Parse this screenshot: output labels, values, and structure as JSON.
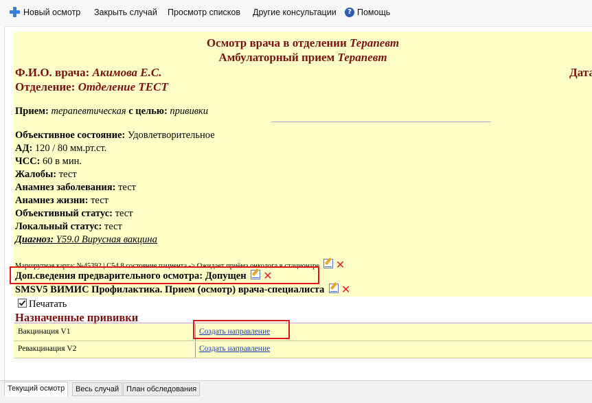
{
  "toolbar": {
    "new_exam": "Новый осмотр",
    "close_case": "Закрыть случай",
    "view_lists": "Просмотр списков",
    "other_consults": "Другие консультации",
    "help": "Помощь",
    "help_icon_glyph": "?"
  },
  "header": {
    "title1_prefix": "Осмотр врача в отделении ",
    "title1_dept": "Терапевт",
    "title2_prefix": "Амбулаторный прием ",
    "title2_dept": "Терапевт"
  },
  "doctor": {
    "label": "Ф.И.О. врача: ",
    "name": "Акимова Е.С.",
    "date_label": "Дата"
  },
  "department": {
    "label": "Отделение: ",
    "name": "Отделение ТЕСТ"
  },
  "reception": {
    "label": "Прием: ",
    "type": "терапевтическая",
    "purpose_label": " с целью: ",
    "purpose": "прививки"
  },
  "fields": [
    {
      "label": "Объективное состояние:",
      "value": " Удовлетворительное"
    },
    {
      "label": "АД:",
      "value": " 120 / 80 мм.рт.ст."
    },
    {
      "label": "ЧСС:",
      "value": " 60 в мин."
    },
    {
      "label": "Жалобы:",
      "value": " тест"
    },
    {
      "label": "Анамнез заболевания:",
      "value": " тест"
    },
    {
      "label": "Анамнез жизни:",
      "value": " тест"
    },
    {
      "label": "Объективный статус:",
      "value": " тест"
    },
    {
      "label": "Локальный статус:",
      "value": " тест"
    }
  ],
  "diagnosis": {
    "label": "Диагноз:",
    "value": " Y59.0 Вирусная вакцина"
  },
  "route_card": "Маршрутная карта: №45392 | С54.8 состояние пациента -> Ожидает приёма онколога в стационаре",
  "dop": {
    "text": "Доп.сведения предварительного осмотра: Допущен"
  },
  "smsv": {
    "text": "SMSV5 ВИМИС Профилактика. Прием (осмотр) врача-специалиста"
  },
  "print_label": "Печатать",
  "vaccinations": {
    "title": "Назначенные прививки",
    "rows": [
      {
        "name": "Вакцинация V1",
        "action": "Создать направление"
      },
      {
        "name": "Ревакцинация V2",
        "action": "Создать направление"
      }
    ]
  },
  "tabs": [
    {
      "label": "Текущий осмотр"
    },
    {
      "label": "Весь случай"
    },
    {
      "label": "План обследования"
    }
  ],
  "colors": {
    "accent": "#7a1212",
    "highlight": "#e01515",
    "panel_bg": "#ffffc8",
    "link": "#1a3fb0"
  }
}
